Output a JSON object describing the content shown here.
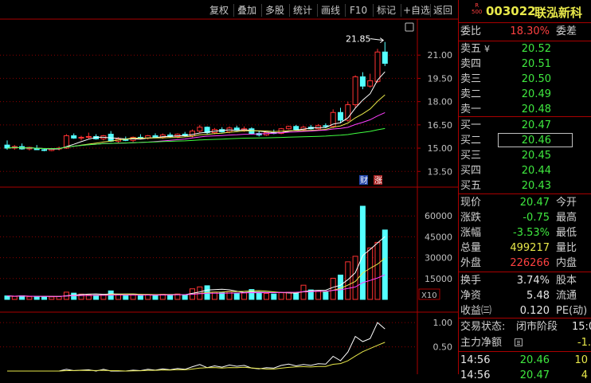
{
  "toolbar": {
    "buttons": [
      "复权",
      "叠加",
      "多股",
      "统计",
      "画线",
      "F10",
      "标记",
      "+自选",
      "返回"
    ]
  },
  "stock": {
    "badge_top": "R",
    "badge_bottom": "500",
    "code": "003022",
    "name": "联泓新科"
  },
  "commission": {
    "label": "委比",
    "value": "18.30%",
    "label2": "委差"
  },
  "asks": [
    {
      "label": "卖五",
      "mark": "¥",
      "price": "20.52"
    },
    {
      "label": "卖四",
      "price": "20.51"
    },
    {
      "label": "卖三",
      "price": "20.50"
    },
    {
      "label": "卖二",
      "price": "20.49"
    },
    {
      "label": "卖一",
      "price": "20.48"
    }
  ],
  "bids": [
    {
      "label": "买一",
      "price": "20.47"
    },
    {
      "label": "买二",
      "price": "20.46",
      "selected": true
    },
    {
      "label": "买三",
      "price": "20.45"
    },
    {
      "label": "买四",
      "price": "20.44"
    },
    {
      "label": "买五",
      "price": "20.43"
    }
  ],
  "quote": [
    {
      "label": "现价",
      "value": "20.47",
      "label2": "今开"
    },
    {
      "label": "涨跌",
      "value": "-0.75",
      "label2": "最高"
    },
    {
      "label": "涨幅",
      "value": "-3.53%",
      "label2": "最低"
    },
    {
      "label": "总量",
      "value": "499217",
      "label2": "量比"
    },
    {
      "label": "外盘",
      "value": "226266",
      "label2": "内盘"
    }
  ],
  "stats": [
    {
      "label": "换手",
      "value": "3.74%",
      "label2": "股本"
    },
    {
      "label": "净资",
      "value": "5.48",
      "label2": "流通"
    },
    {
      "label": "收益㈢",
      "value": "0.120",
      "label2": "PE(动)"
    }
  ],
  "status": {
    "label": "交易状态:",
    "value": "闭市阶段",
    "time": "15:0"
  },
  "capital": {
    "label": "主力净额",
    "icon": "list-icon",
    "value": "-1."
  },
  "ticks": [
    {
      "time": "14:56",
      "price": "20.46",
      "vol": "10"
    },
    {
      "time": "14:56",
      "price": "20.47",
      "vol": "4"
    }
  ],
  "chart": {
    "max_label": "21.85",
    "price_ticks": [
      "21.00",
      "19.50",
      "18.00",
      "16.50",
      "15.00",
      "13.50"
    ],
    "volume_ticks": [
      "60000",
      "45000",
      "30000",
      "15000"
    ],
    "volume_unit": "X10",
    "indicator_ticks": [
      "1.00",
      "0.50"
    ],
    "badge_cai": "财",
    "badge_zhang": "涨",
    "colors": {
      "up": "#ff3232",
      "down": "#54ffff",
      "grid": "#8b0000"
    }
  },
  "chart_data": {
    "type": "candlestick",
    "title": "",
    "y_range_price": [
      13.0,
      22.5
    ],
    "y_range_volume": [
      0,
      75000
    ],
    "candles": [
      {
        "o": 15.2,
        "h": 15.5,
        "l": 14.9,
        "c": 15.0,
        "v": 2500
      },
      {
        "o": 15.0,
        "h": 15.2,
        "l": 14.9,
        "c": 15.1,
        "v": 2100
      },
      {
        "o": 15.1,
        "h": 15.3,
        "l": 14.9,
        "c": 14.95,
        "v": 2600
      },
      {
        "o": 14.95,
        "h": 15.1,
        "l": 14.85,
        "c": 15.05,
        "v": 1900
      },
      {
        "o": 15.0,
        "h": 15.2,
        "l": 14.9,
        "c": 14.9,
        "v": 2200
      },
      {
        "o": 14.9,
        "h": 15.0,
        "l": 14.8,
        "c": 14.85,
        "v": 2000
      },
      {
        "o": 14.85,
        "h": 15.0,
        "l": 14.8,
        "c": 14.95,
        "v": 1800
      },
      {
        "o": 14.95,
        "h": 15.1,
        "l": 14.85,
        "c": 15.0,
        "v": 2100
      },
      {
        "o": 15.0,
        "h": 15.9,
        "l": 14.95,
        "c": 15.8,
        "v": 5200
      },
      {
        "o": 15.8,
        "h": 15.95,
        "l": 15.6,
        "c": 15.65,
        "v": 4500
      },
      {
        "o": 15.65,
        "h": 15.8,
        "l": 15.5,
        "c": 15.7,
        "v": 3800
      },
      {
        "o": 15.7,
        "h": 16.0,
        "l": 15.6,
        "c": 15.75,
        "v": 3300
      },
      {
        "o": 15.75,
        "h": 15.9,
        "l": 15.55,
        "c": 15.6,
        "v": 3000
      },
      {
        "o": 15.6,
        "h": 15.85,
        "l": 15.5,
        "c": 15.8,
        "v": 3600
      },
      {
        "o": 15.9,
        "h": 16.1,
        "l": 15.4,
        "c": 15.45,
        "v": 6100
      },
      {
        "o": 15.45,
        "h": 15.7,
        "l": 15.35,
        "c": 15.6,
        "v": 3400
      },
      {
        "o": 15.6,
        "h": 15.75,
        "l": 15.45,
        "c": 15.5,
        "v": 3000
      },
      {
        "o": 15.5,
        "h": 15.75,
        "l": 15.4,
        "c": 15.7,
        "v": 3100
      },
      {
        "o": 15.7,
        "h": 15.9,
        "l": 15.6,
        "c": 15.65,
        "v": 2800
      },
      {
        "o": 15.65,
        "h": 15.85,
        "l": 15.55,
        "c": 15.8,
        "v": 3500
      },
      {
        "o": 15.8,
        "h": 15.95,
        "l": 15.65,
        "c": 15.7,
        "v": 2900
      },
      {
        "o": 15.7,
        "h": 15.95,
        "l": 15.6,
        "c": 15.85,
        "v": 3700
      },
      {
        "o": 15.85,
        "h": 16.0,
        "l": 15.7,
        "c": 15.75,
        "v": 3200
      },
      {
        "o": 15.75,
        "h": 15.95,
        "l": 15.65,
        "c": 15.9,
        "v": 3900
      },
      {
        "o": 15.9,
        "h": 16.05,
        "l": 15.75,
        "c": 15.8,
        "v": 3300
      },
      {
        "o": 15.8,
        "h": 16.2,
        "l": 15.7,
        "c": 16.1,
        "v": 7600
      },
      {
        "o": 16.1,
        "h": 16.5,
        "l": 16.0,
        "c": 16.35,
        "v": 9000
      },
      {
        "o": 16.35,
        "h": 16.4,
        "l": 15.9,
        "c": 16.0,
        "v": 9800
      },
      {
        "o": 16.0,
        "h": 16.3,
        "l": 15.9,
        "c": 16.2,
        "v": 5200
      },
      {
        "o": 16.2,
        "h": 16.35,
        "l": 16.0,
        "c": 16.05,
        "v": 4800
      },
      {
        "o": 16.05,
        "h": 16.4,
        "l": 15.95,
        "c": 16.3,
        "v": 5600
      },
      {
        "o": 16.3,
        "h": 16.45,
        "l": 16.1,
        "c": 16.15,
        "v": 4200
      },
      {
        "o": 16.15,
        "h": 16.4,
        "l": 16.05,
        "c": 16.25,
        "v": 4700
      },
      {
        "o": 16.25,
        "h": 16.35,
        "l": 15.9,
        "c": 15.95,
        "v": 7100
      },
      {
        "o": 15.95,
        "h": 16.1,
        "l": 15.75,
        "c": 15.85,
        "v": 5000
      },
      {
        "o": 15.85,
        "h": 16.05,
        "l": 15.8,
        "c": 16.0,
        "v": 4300
      },
      {
        "o": 16.0,
        "h": 16.2,
        "l": 15.9,
        "c": 15.95,
        "v": 3900
      },
      {
        "o": 15.95,
        "h": 16.3,
        "l": 15.9,
        "c": 16.25,
        "v": 4800
      },
      {
        "o": 16.25,
        "h": 16.45,
        "l": 16.2,
        "c": 16.4,
        "v": 5100
      },
      {
        "o": 16.4,
        "h": 16.5,
        "l": 16.15,
        "c": 16.2,
        "v": 4400
      },
      {
        "o": 16.2,
        "h": 16.45,
        "l": 16.1,
        "c": 16.35,
        "v": 10200
      },
      {
        "o": 16.35,
        "h": 16.5,
        "l": 16.2,
        "c": 16.25,
        "v": 6800
      },
      {
        "o": 16.25,
        "h": 16.55,
        "l": 16.2,
        "c": 16.45,
        "v": 6200
      },
      {
        "o": 16.45,
        "h": 16.6,
        "l": 16.3,
        "c": 16.4,
        "v": 5200
      },
      {
        "o": 16.4,
        "h": 17.5,
        "l": 16.3,
        "c": 17.3,
        "v": 15200
      },
      {
        "o": 17.3,
        "h": 17.6,
        "l": 16.6,
        "c": 16.8,
        "v": 17500
      },
      {
        "o": 16.8,
        "h": 18.0,
        "l": 16.7,
        "c": 17.8,
        "v": 27000
      },
      {
        "o": 17.8,
        "h": 19.7,
        "l": 17.6,
        "c": 19.6,
        "v": 31000
      },
      {
        "o": 19.6,
        "h": 19.9,
        "l": 18.8,
        "c": 19.0,
        "v": 67000
      },
      {
        "o": 19.0,
        "h": 19.8,
        "l": 18.9,
        "c": 19.35,
        "v": 37000
      },
      {
        "o": 19.3,
        "h": 21.4,
        "l": 19.2,
        "c": 21.2,
        "v": 41000
      },
      {
        "o": 21.2,
        "h": 21.85,
        "l": 20.3,
        "c": 20.47,
        "v": 49900
      }
    ]
  }
}
